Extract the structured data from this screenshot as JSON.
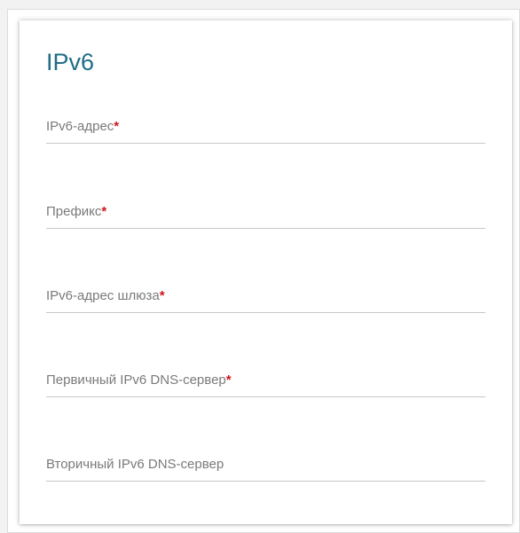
{
  "section": {
    "title": "IPv6"
  },
  "fields": [
    {
      "label": "IPv6-адрес",
      "required_mark": "*",
      "value": ""
    },
    {
      "label": "Префикс",
      "required_mark": "*",
      "value": ""
    },
    {
      "label": "IPv6-адрес шлюза",
      "required_mark": "*",
      "value": ""
    },
    {
      "label": "Первичный IPv6 DNS-сервер",
      "required_mark": "*",
      "value": ""
    },
    {
      "label": "Вторичный IPv6 DNS-сервер",
      "value": ""
    }
  ],
  "colors": {
    "title": "#1f6e86",
    "label": "#7a7a7a",
    "required": "#d0141c",
    "underline": "#c8c8c8"
  }
}
